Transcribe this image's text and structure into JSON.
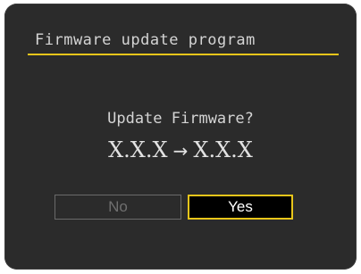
{
  "dialog": {
    "title": "Firmware update program",
    "question": "Update Firmware?",
    "version_from": "X.X.X",
    "arrow": "→",
    "version_to": "X.X.X"
  },
  "buttons": {
    "no_label": "No",
    "yes_label": "Yes",
    "selected": "Yes"
  },
  "colors": {
    "accent": "#e8c51a",
    "background": "#2b2b2b",
    "text": "#d4d4d4",
    "disabled_text": "#6f6f6f"
  }
}
